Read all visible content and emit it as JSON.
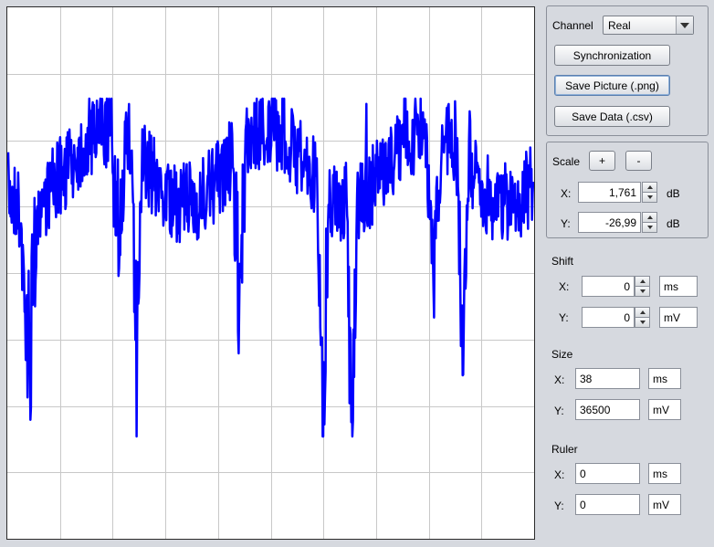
{
  "channel": {
    "label": "Channel",
    "selected": "Real"
  },
  "buttons": {
    "sync": "Synchronization",
    "save_picture": "Save Picture (.png)",
    "save_data": "Save Data (.csv)"
  },
  "scale": {
    "label": "Scale",
    "plus": "+",
    "minus": "-",
    "x_label": "X:",
    "x_value": "1,761",
    "x_unit": "dB",
    "y_label": "Y:",
    "y_value": "-26,99",
    "y_unit": "dB"
  },
  "shift": {
    "label": "Shift",
    "x_label": "X:",
    "x_value": "0",
    "x_unit": "ms",
    "y_label": "Y:",
    "y_value": "0",
    "y_unit": "mV"
  },
  "size": {
    "label": "Size",
    "x_label": "X:",
    "x_value": "38",
    "x_unit": "ms",
    "y_label": "Y:",
    "y_value": "36500",
    "y_unit": "mV"
  },
  "ruler": {
    "label": "Ruler",
    "x_label": "X:",
    "x_value": "0",
    "x_unit": "ms",
    "y_label": "Y:",
    "y_value": "0",
    "y_unit": "mV"
  },
  "plot": {
    "trace_color": "#0000ff",
    "grid_color": "#c8c8c8",
    "background": "#ffffff",
    "grid_columns": 10,
    "grid_rows": 8
  }
}
